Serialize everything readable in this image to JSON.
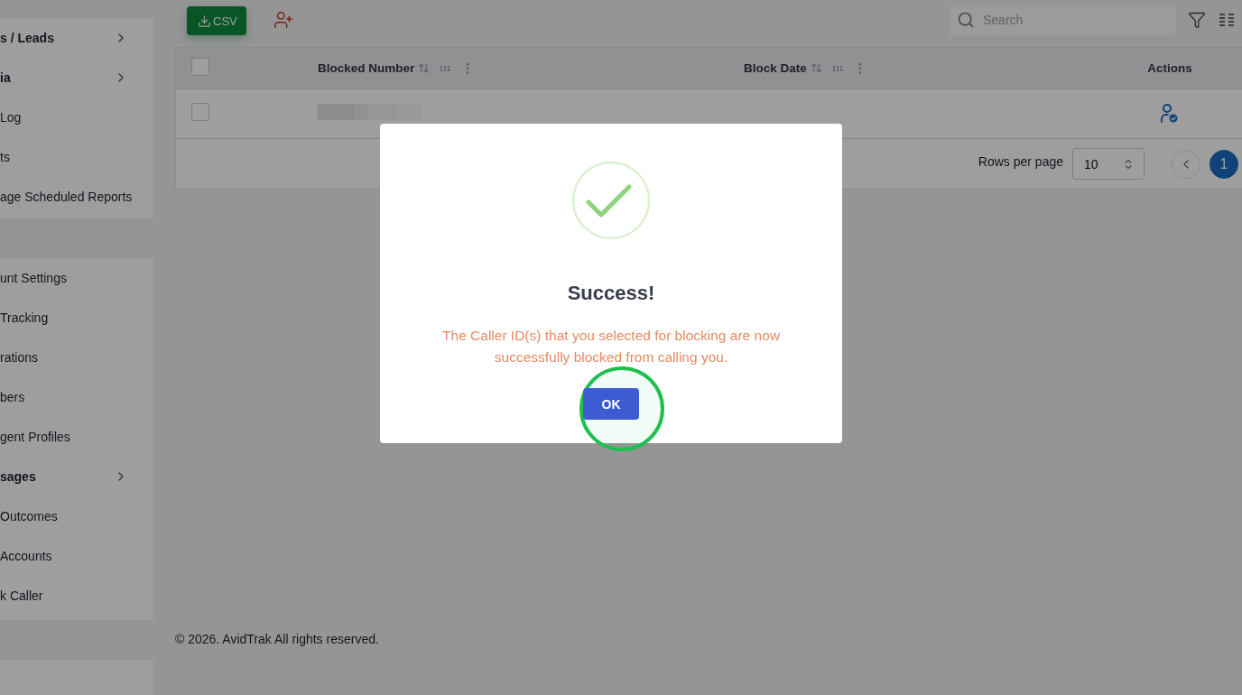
{
  "sidebar": {
    "groups": [
      {
        "items": [
          {
            "label": "s / Leads",
            "kind": "group"
          },
          {
            "label": "ia",
            "kind": "group"
          },
          {
            "label": "Log",
            "kind": "link"
          },
          {
            "label": "ts",
            "kind": "link"
          },
          {
            "label": "age Scheduled Reports",
            "kind": "link"
          }
        ]
      },
      {
        "items": [
          {
            "label": "unt Settings",
            "kind": "link"
          },
          {
            "label": "Tracking",
            "kind": "link"
          },
          {
            "label": "rations",
            "kind": "link"
          },
          {
            "label": "bers",
            "kind": "link"
          },
          {
            "label": "gent Profiles",
            "kind": "link"
          },
          {
            "label": "sages",
            "kind": "group"
          },
          {
            "label": "Outcomes",
            "kind": "link"
          },
          {
            "label": "Accounts",
            "kind": "link"
          },
          {
            "label": "k Caller",
            "kind": "link"
          }
        ]
      }
    ]
  },
  "toolbar": {
    "export_button": "CSV",
    "search": {
      "placeholder": "Search"
    }
  },
  "table": {
    "select_all_checked": false,
    "columns": [
      {
        "label": "Blocked Number",
        "sortable": true
      },
      {
        "label": "Block Date",
        "sortable": true
      },
      {
        "label": "Actions",
        "sortable": false
      }
    ],
    "rows": [
      {
        "checked": false
      }
    ]
  },
  "pagination": {
    "rows_per_page_label": "Rows per page",
    "rows_per_page": "10",
    "pages": [
      {
        "label": "1",
        "selected": true
      }
    ]
  },
  "footer": "© 2026. AvidTrak All rights reserved.",
  "dialog": {
    "title": "Success!",
    "message": "The Caller ID(s) that you selected for blocking are now successfully blocked from calling you.",
    "button": "OK",
    "button_highlighted": true
  }
}
